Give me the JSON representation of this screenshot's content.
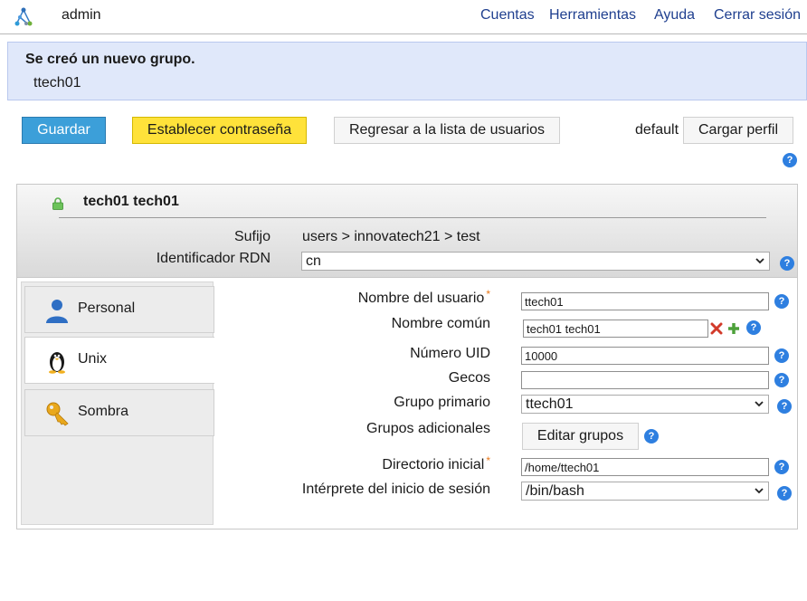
{
  "topbar": {
    "user": "admin",
    "nav": [
      "Cuentas",
      "Herramientas",
      "Ayuda",
      "Cerrar sesión"
    ]
  },
  "message": {
    "title": "Se creó un nuevo grupo.",
    "text": "ttech01"
  },
  "toolbar": {
    "save_label": "Guardar",
    "set_password_label": "Establecer contraseña",
    "back_label": "Regresar a la lista de usuarios",
    "profile_value": "default",
    "load_profile_label": "Cargar perfil"
  },
  "account": {
    "title": "tech01 tech01",
    "suffix_label": "Sufijo",
    "suffix_value": "users > innovatech21 > test",
    "rdn_label": "Identificador RDN",
    "rdn_value": "cn"
  },
  "tabs": [
    {
      "label": "Personal",
      "icon": "person-icon",
      "active": false
    },
    {
      "label": "Unix",
      "icon": "penguin-icon",
      "active": true
    },
    {
      "label": "Sombra",
      "icon": "key-icon",
      "active": false
    }
  ],
  "unix_form": {
    "username_label": "Nombre del usuario",
    "username_value": "ttech01",
    "common_name_label": "Nombre común",
    "common_name_value": "tech01 tech01",
    "uid_label": "Número UID",
    "uid_value": "10000",
    "gecos_label": "Gecos",
    "gecos_value": "",
    "primary_group_label": "Grupo primario",
    "primary_group_value": "ttech01",
    "additional_groups_label": "Grupos adicionales",
    "edit_groups_label": "Editar grupos",
    "home_dir_label": "Directorio inicial",
    "home_dir_value": "/home/ttech01",
    "shell_label": "Intérprete del inicio de sesión",
    "shell_value": "/bin/bash",
    "required_mark": "*"
  },
  "help_glyph": "?",
  "colors": {
    "nav_link": "#1f3f8f",
    "message_bg": "#e0e8fa",
    "save_button": "#3c9fd9",
    "password_button": "#ffe23a",
    "help_icon": "#2e7fe0",
    "required_mark": "#e8781a"
  }
}
